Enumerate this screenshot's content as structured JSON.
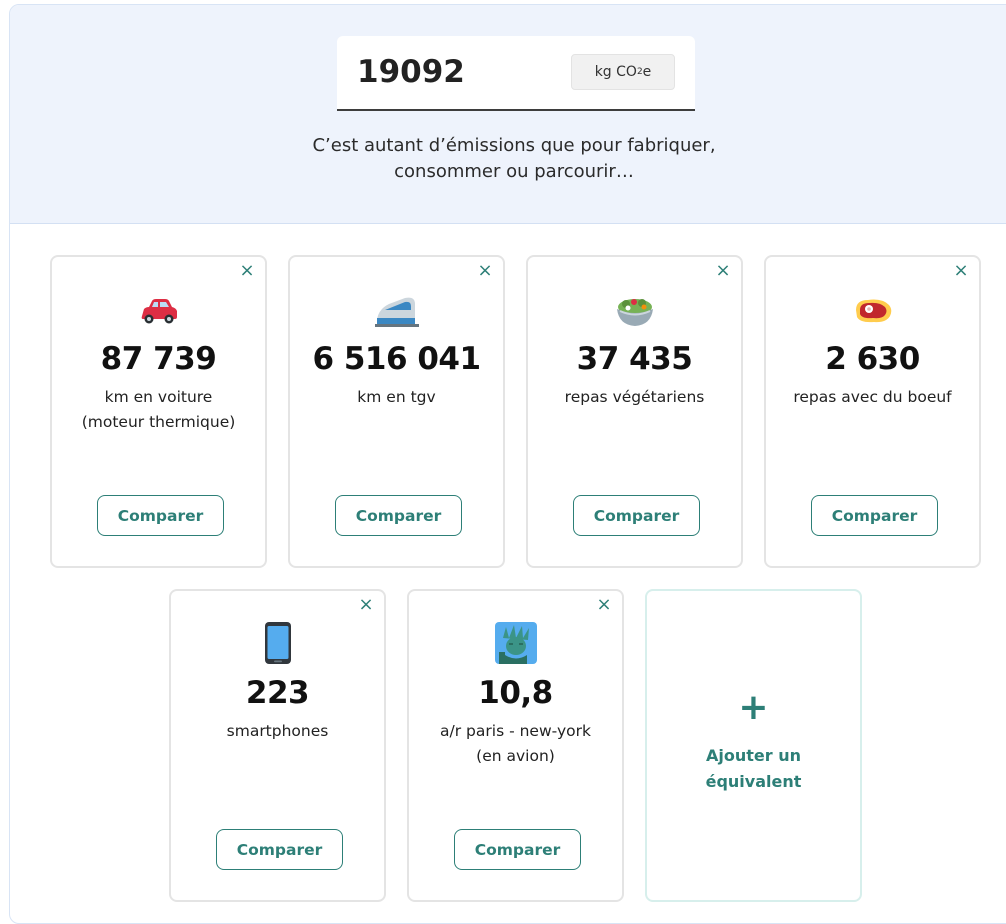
{
  "header": {
    "value": "19092",
    "unit_prefix": "kg CO",
    "unit_sub": "2",
    "unit_suffix": "e",
    "subtitle_line1": "C’est autant d’émissions que pour fabriquer,",
    "subtitle_line2": "consommer ou parcourir…"
  },
  "cards": [
    {
      "icon": "car-icon",
      "number": "87 739",
      "label_line1": "km en voiture",
      "label_line2": "(moteur thermique)",
      "button": "Comparer",
      "close": "×"
    },
    {
      "icon": "train-icon",
      "number": "6 516 041",
      "label_line1": "km en tgv",
      "label_line2": "",
      "button": "Comparer",
      "close": "×"
    },
    {
      "icon": "salad-icon",
      "number": "37 435",
      "label_line1": "repas végétariens",
      "label_line2": "",
      "button": "Comparer",
      "close": "×"
    },
    {
      "icon": "steak-icon",
      "number": "2 630",
      "label_line1": "repas avec du boeuf",
      "label_line2": "",
      "button": "Comparer",
      "close": "×"
    },
    {
      "icon": "smartphone-icon",
      "number": "223",
      "label_line1": "smartphones",
      "label_line2": "",
      "button": "Comparer",
      "close": "×"
    },
    {
      "icon": "statue-of-liberty-icon",
      "number": "10,8",
      "label_line1": "a/r paris - new-york",
      "label_line2": "(en avion)",
      "button": "Comparer",
      "close": "×"
    }
  ],
  "add_card": {
    "plus": "+",
    "label_line1": "Ajouter un",
    "label_line2": "équivalent"
  },
  "colors": {
    "accent": "#2d7f77",
    "band": "#eef3fc"
  }
}
